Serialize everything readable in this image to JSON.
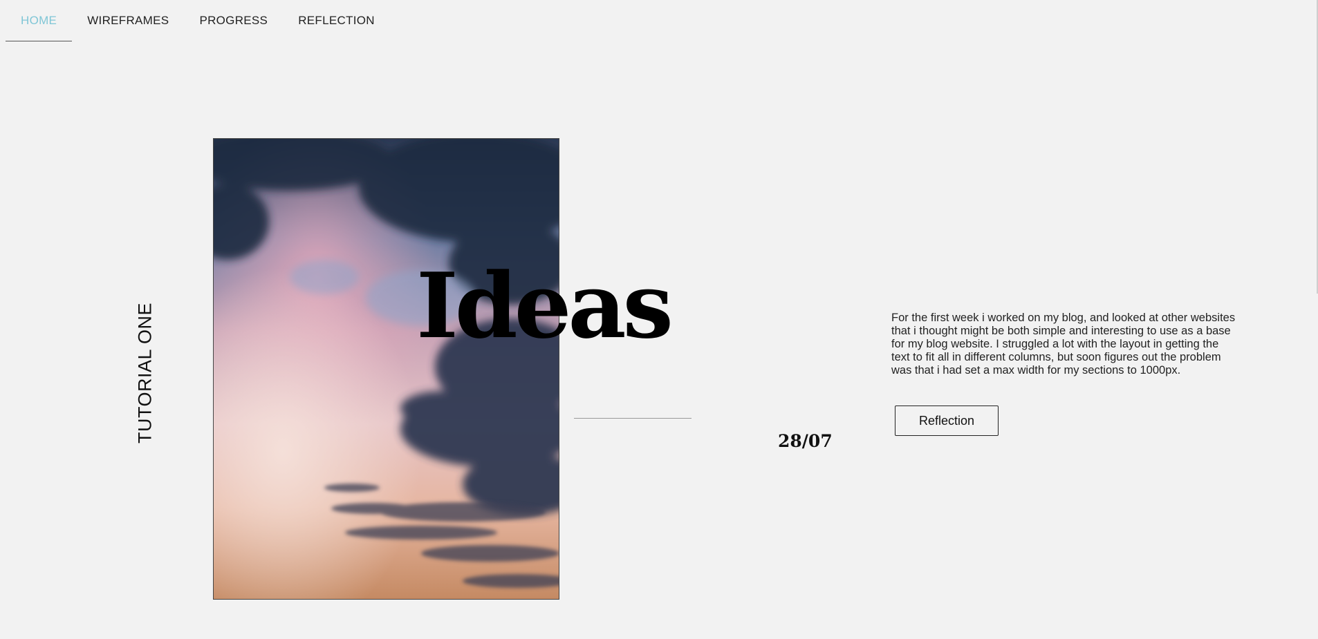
{
  "nav": {
    "items": [
      {
        "label": "HOME",
        "active": true
      },
      {
        "label": "WIREFRAMES",
        "active": false
      },
      {
        "label": "PROGRESS",
        "active": false
      },
      {
        "label": "REFLECTION",
        "active": false
      }
    ]
  },
  "hero": {
    "vertical_label": "TUTORIAL ONE",
    "heading": "Ideas",
    "date": "28/07",
    "body": "For the first week i worked on my blog, and looked at other websites that i thought might be both simple and interesting to use as a base for my blog website. I struggled a lot with the layout in getting the text to fit all in different columns, but soon figures out the problem was that i had set a max width for my sections to 1000px.",
    "button_label": "Reflection"
  },
  "colors": {
    "background": "#f2f2f2",
    "active_nav": "#7fc6d6",
    "text": "#222222"
  }
}
